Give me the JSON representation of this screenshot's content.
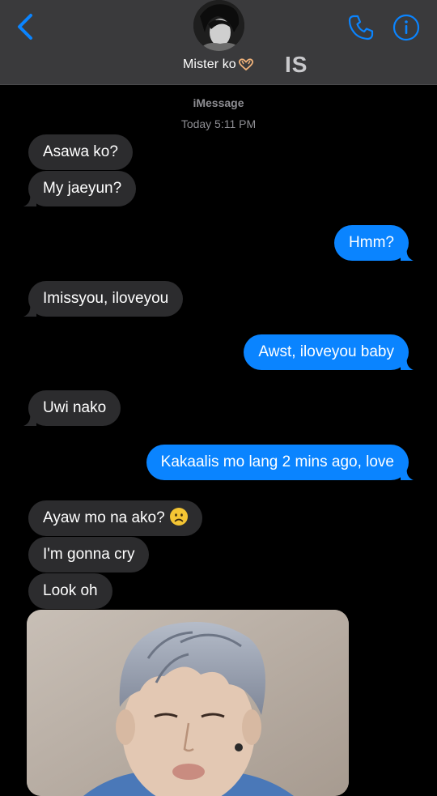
{
  "header": {
    "contact_name": "Mister ko",
    "badge_text": "IS",
    "back_icon": "chevron-left-icon",
    "call_icon": "phone-icon",
    "info_icon": "info-icon",
    "accent_color": "#0a84ff"
  },
  "thread": {
    "service": "iMessage",
    "timestamp": "Today 5:11 PM"
  },
  "messages": [
    {
      "text": "Asawa ko?",
      "from": "them"
    },
    {
      "text": "My jaeyun?",
      "from": "them"
    },
    {
      "text": "Hmm?",
      "from": "me"
    },
    {
      "text": "Imissyou, iloveyou",
      "from": "them"
    },
    {
      "text": "Awst, iloveyou baby",
      "from": "me"
    },
    {
      "text": "Uwi nako",
      "from": "them"
    },
    {
      "text": "Kakaalis mo lang 2 mins ago, love",
      "from": "me"
    },
    {
      "text": "Ayaw mo na ako?",
      "from": "them",
      "emoji": "frowning-face-emoji"
    },
    {
      "text": "I'm gonna cry",
      "from": "them"
    },
    {
      "text": "Look oh",
      "from": "them"
    }
  ],
  "attachment": {
    "type": "photo",
    "from": "them"
  },
  "colors": {
    "incoming_bubble": "#2c2c2e",
    "outgoing_bubble": "#0a84ff",
    "header_bg": "#3a3a3c"
  }
}
